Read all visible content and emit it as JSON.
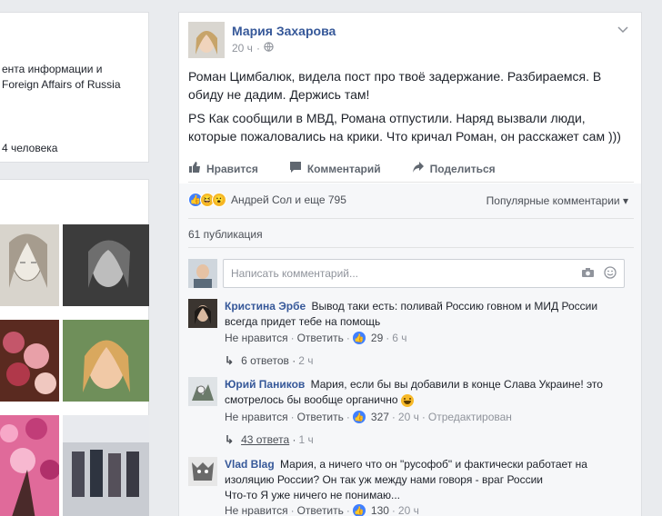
{
  "left": {
    "info_line1": "ента информации и",
    "info_line2": "Foreign Affairs of Russia",
    "people": "4 человека"
  },
  "post": {
    "author": "Мария Захарова",
    "time": "20 ч",
    "dot": "·",
    "paragraph1": "Роман Цимбалюк, видела пост про твоё задержание. Разбираемся. В обиду не дадим. Держись там!",
    "paragraph2": "PS Как сообщили в МВД, Романа отпустили. Наряд вызвали люди, которые пожаловались на крики. Что кричал Роман, он расскажет сам )))",
    "actions": {
      "like": "Нравится",
      "comment": "Комментарий",
      "share": "Поделиться"
    },
    "reactions_text": "Андрей Сол и еще 795",
    "sort_label": "Популярные комментарии",
    "publications": "61 публикация",
    "write_placeholder": "Написать комментарий..."
  },
  "comments": [
    {
      "name": "Кристина Эрбе",
      "text": "Вывод таки есть: поливай Россию говном и МИД России всегда придет тебе на помощь",
      "dislike": "Не нравится",
      "reply": "Ответить",
      "likes": "29",
      "time": "6 ч",
      "replies": "6 ответов",
      "replies_time": "2 ч"
    },
    {
      "name": "Юрий Паников",
      "text": "Мария, если бы вы добавили в конце Слава Украине! это смотрелось бы вообще органично",
      "dislike": "Не нравится",
      "reply": "Ответить",
      "likes": "327",
      "time": "20 ч",
      "edited": "Отредактирован",
      "replies": "43 ответа",
      "replies_time": "1 ч"
    },
    {
      "name": "Vlad Blag",
      "text": "Мария, а ничего что он \"русофоб\" и фактически работает на изоляцию России? Он так уж между нами говоря - враг России",
      "text_line3": "Что-то Я уже ничего не понимаю...",
      "dislike": "Не нравится",
      "reply": "Ответить",
      "likes": "130",
      "time": "20 ч"
    }
  ],
  "colors": {
    "link": "#365899",
    "background": "#e9ebee",
    "like_blue": "#4080ff"
  }
}
